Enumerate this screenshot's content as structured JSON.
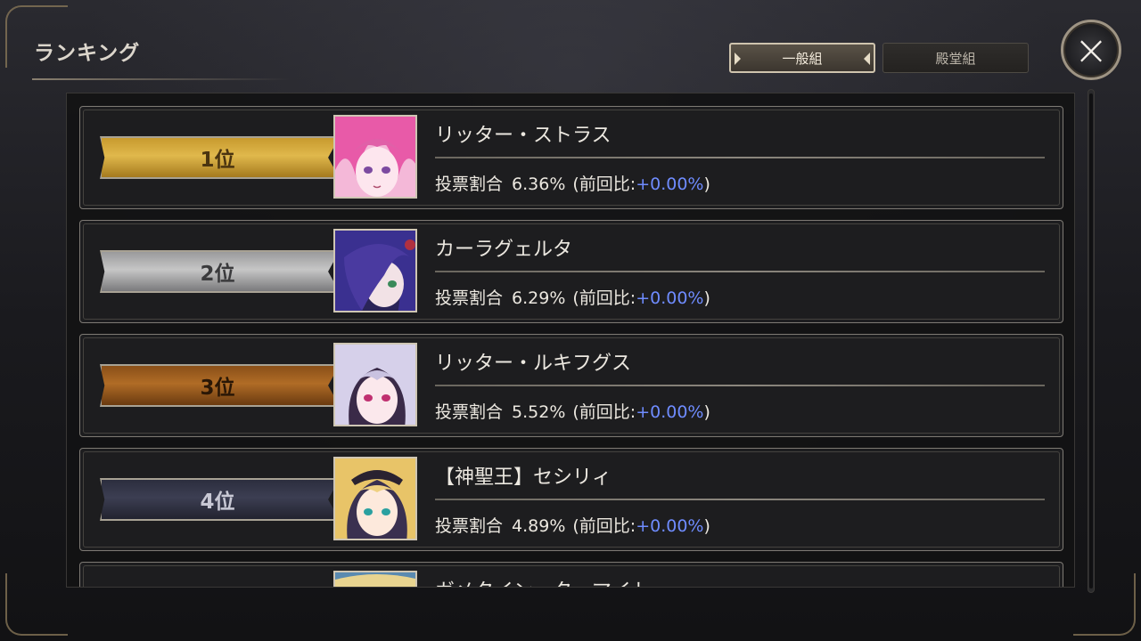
{
  "screen": {
    "title": "ランキング",
    "close_icon": "×"
  },
  "tabs": [
    {
      "label": "一般組",
      "active": true
    },
    {
      "label": "殿堂組",
      "active": false
    }
  ],
  "vote_label": "投票割合",
  "prev_label": "(前回比:",
  "prev_close": ")",
  "rankings": [
    {
      "rank": "1位",
      "name": "リッター・ストラス",
      "share": "6.36%",
      "delta": "+0.00%",
      "portrait_color": "#e85aa8"
    },
    {
      "rank": "2位",
      "name": "カーラグェルタ",
      "share": "6.29%",
      "delta": "+0.00%",
      "portrait_color": "#4a3aa0"
    },
    {
      "rank": "3位",
      "name": "リッター・ルキフグス",
      "share": "5.52%",
      "delta": "+0.00%",
      "portrait_color": "#c9c2e0"
    },
    {
      "rank": "4位",
      "name": "【神聖王】セシリィ",
      "share": "4.89%",
      "delta": "+0.00%",
      "portrait_color": "#e8c468"
    },
    {
      "rank": "",
      "name": "ガメタイン・ターマイト",
      "share": "",
      "delta": "",
      "portrait_color": "#e8d490"
    }
  ],
  "colors": {
    "delta_text": "#6f8cff",
    "gold": "#e0b84c",
    "silver": "#c6c6c6",
    "bronze": "#b06c26",
    "fourth": "#3c3e52"
  }
}
